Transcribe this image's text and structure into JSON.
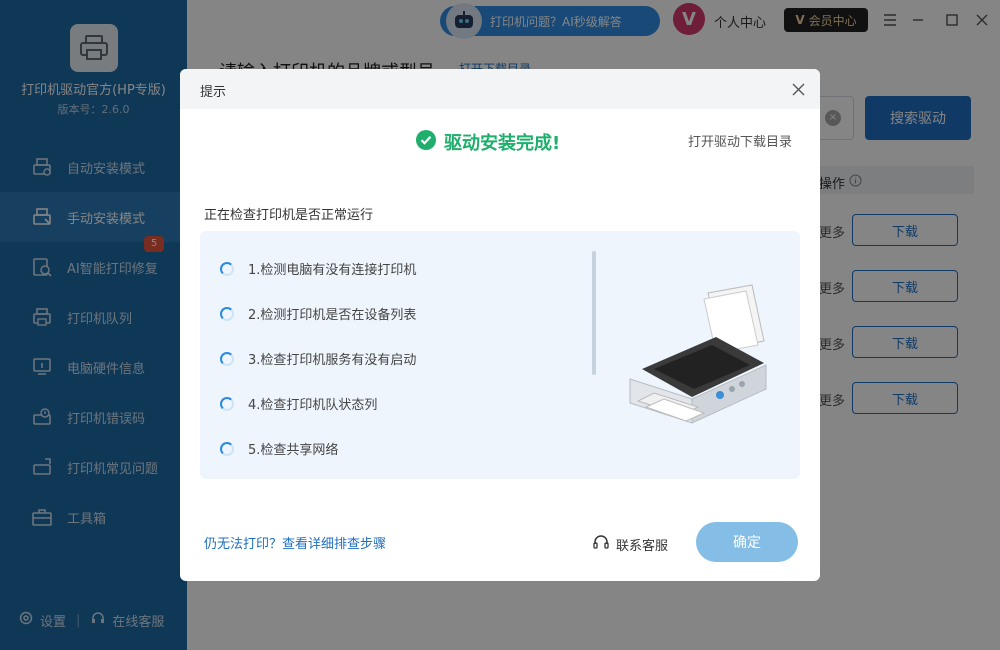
{
  "app": {
    "title": "打印机驱动官方(HP专版)",
    "version": "版本号：2.6.0"
  },
  "sidebar": {
    "items": [
      {
        "label": "自动安装模式",
        "icon": "auto-install-icon"
      },
      {
        "label": "手动安装模式",
        "icon": "manual-install-icon",
        "active": true
      },
      {
        "label": "AI智能打印修复",
        "icon": "ai-repair-icon",
        "badge": "5"
      },
      {
        "label": "打印机队列",
        "icon": "printer-queue-icon"
      },
      {
        "label": "电脑硬件信息",
        "icon": "hardware-info-icon"
      },
      {
        "label": "打印机错误码",
        "icon": "error-code-icon"
      },
      {
        "label": "打印机常见问题",
        "icon": "faq-icon"
      },
      {
        "label": "工具箱",
        "icon": "toolbox-icon"
      }
    ],
    "footer": {
      "settings": "设置",
      "support": "在线客服"
    }
  },
  "topbar": {
    "ai_pill": "打印机问题？AI秒级解答",
    "vip_letter": "V",
    "personal": "个人中心",
    "member": "会员中心",
    "member_letter": "V"
  },
  "main": {
    "search_label": "请输入打印机的品牌或型号",
    "search_link": "打开下载目录",
    "search_button": "搜索驱动",
    "ops_header": "操作",
    "row_more": "更多",
    "download": "下载"
  },
  "dialog": {
    "title": "提示",
    "done_text": "驱动安装完成!",
    "open_dir": "打开驱动下载目录",
    "checking": "正在检查打印机是否正常运行",
    "checks": [
      "1.检测电脑有没有连接打印机",
      "2.检测打印机是否在设备列表",
      "3.检查打印机服务有没有启动",
      "4.检查打印机队状态列",
      "5.检查共享网络"
    ],
    "help_link": "仍无法打印？查看详细排查步骤",
    "support": "联系客服",
    "ok": "确定"
  },
  "colors": {
    "sidebar": "#1e6aa6",
    "accent": "#1f6fc1",
    "success": "#1fae6b",
    "ok_button": "#84bde6"
  }
}
